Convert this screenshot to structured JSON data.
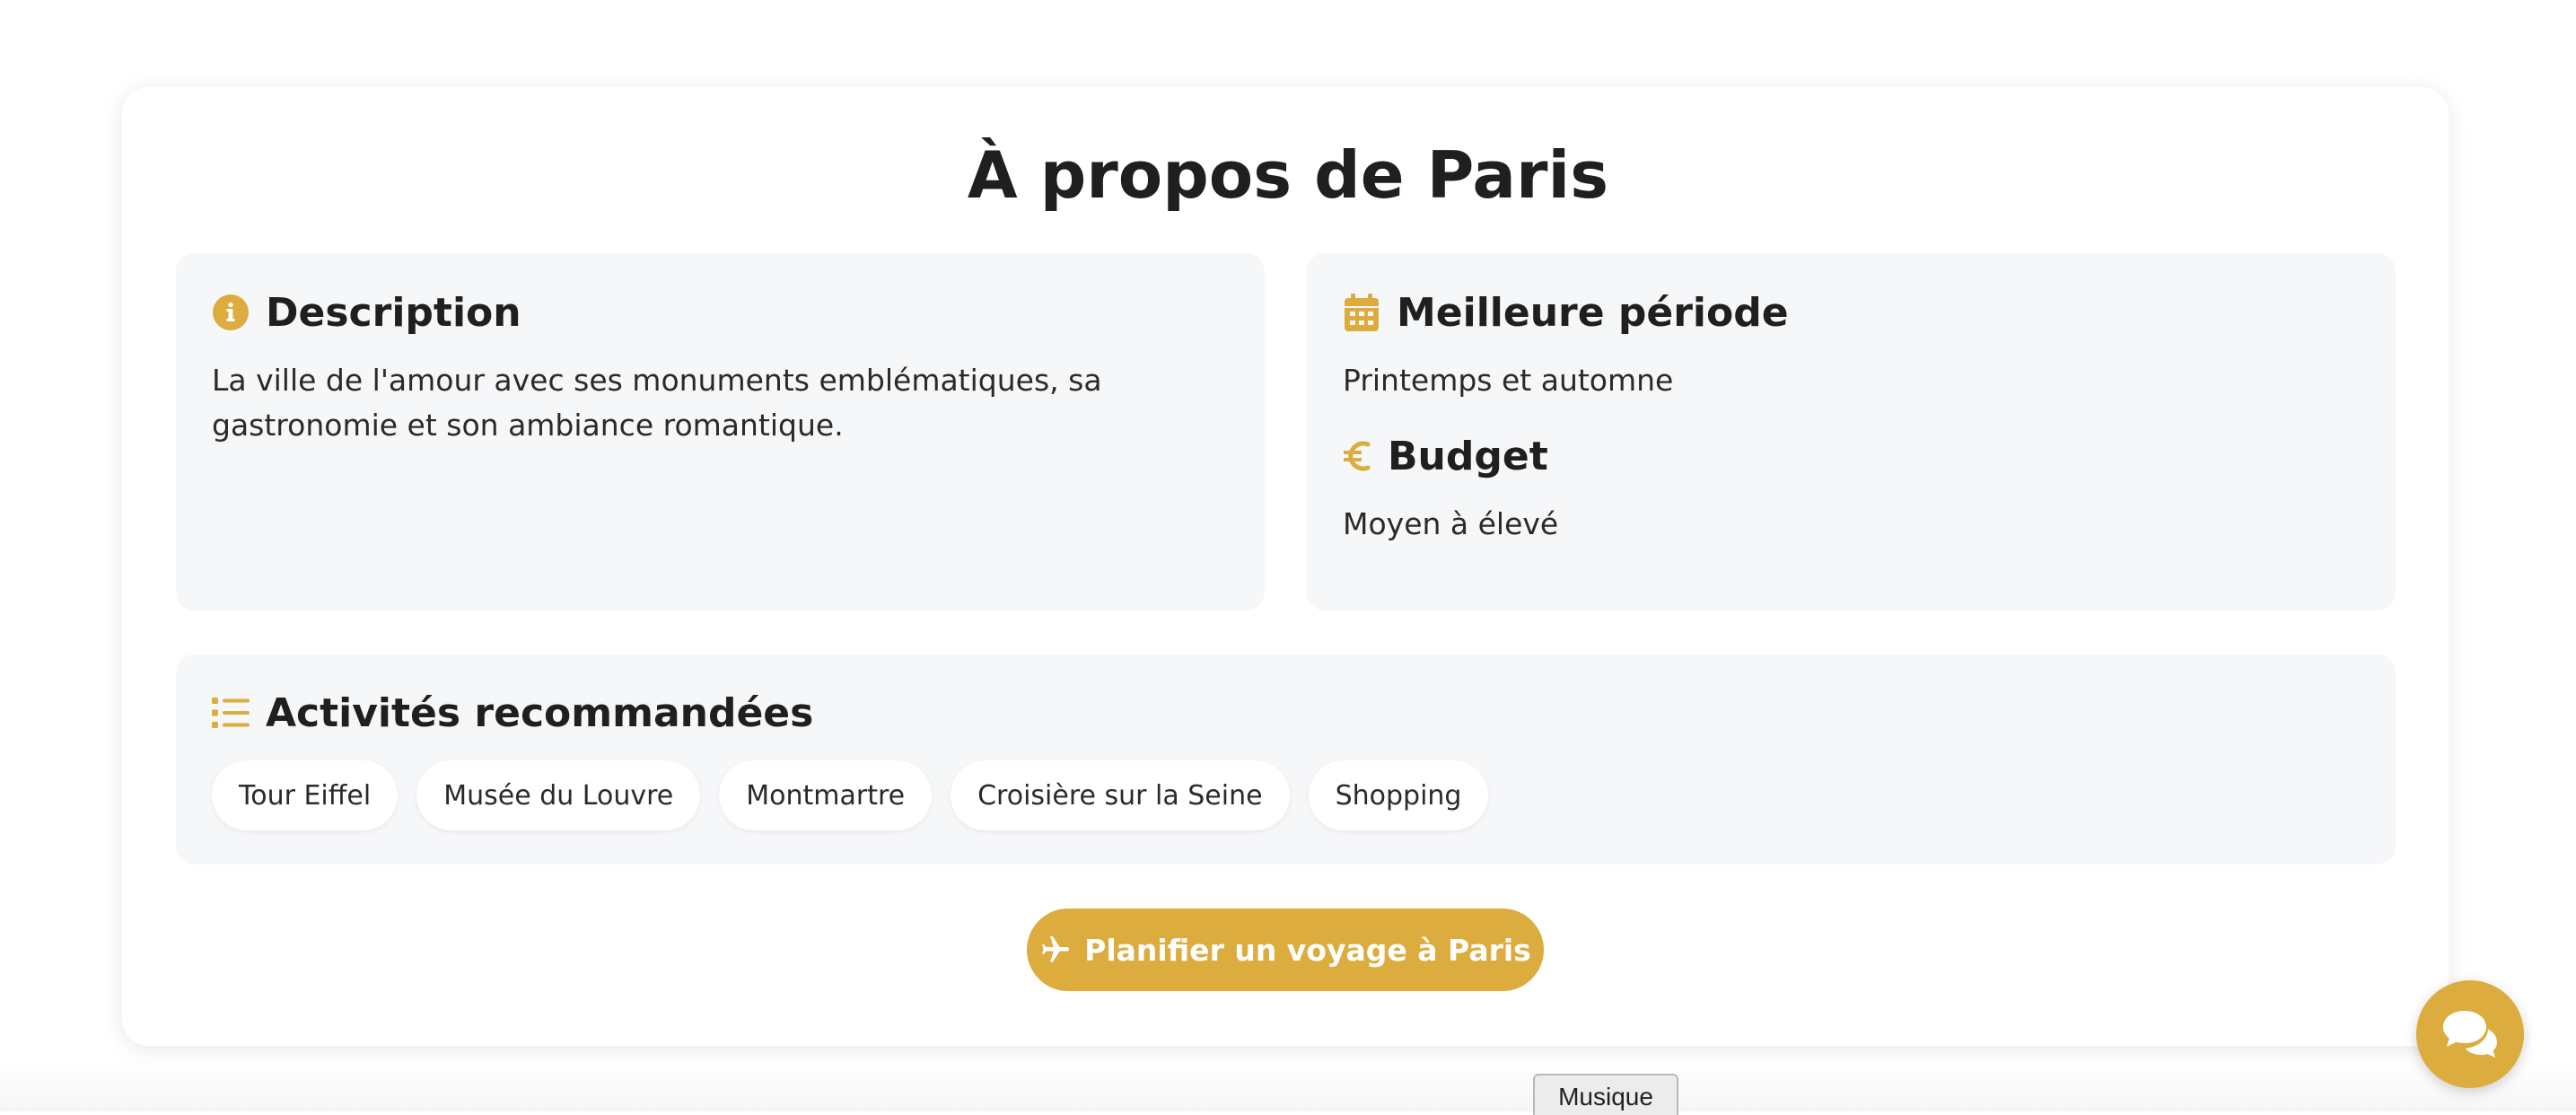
{
  "section": {
    "title": "À propos de Paris"
  },
  "description": {
    "icon": "info-circle-icon",
    "heading": "Description",
    "text": "La ville de l'amour avec ses monuments emblématiques, sa gastronomie et son ambiance romantique."
  },
  "best_period": {
    "icon": "calendar-icon",
    "heading": "Meilleure période",
    "text": "Printemps et automne"
  },
  "budget": {
    "icon": "euro-icon",
    "heading": "Budget",
    "text": "Moyen à élevé"
  },
  "activities": {
    "icon": "list-icon",
    "heading": "Activités recommandées",
    "items": [
      "Tour Eiffel",
      "Musée du Louvre",
      "Montmartre",
      "Croisière sur la Seine",
      "Shopping"
    ]
  },
  "plan_button": {
    "icon": "plane-icon",
    "label": "Planifier un voyage à Paris"
  },
  "chat_button": {
    "icon": "chat-bubbles-icon"
  },
  "music_button": {
    "label": "Musique"
  },
  "colors": {
    "accent": "#dcac3e",
    "panel_bg": "#f6f7f9",
    "text": "#1f1f1f"
  }
}
